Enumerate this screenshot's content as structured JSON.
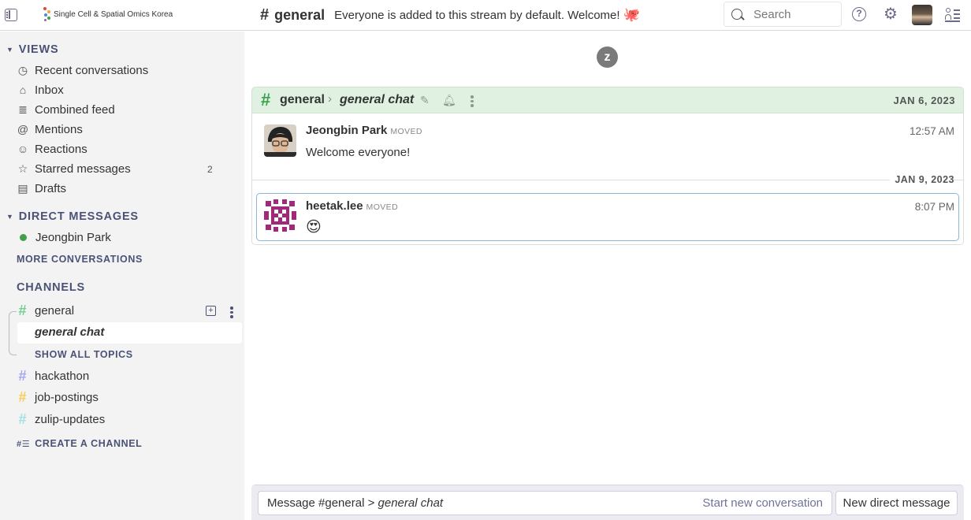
{
  "org": {
    "name": "Single Cell & Spatial Omics Korea"
  },
  "header": {
    "hash": "#",
    "stream": "general",
    "description": "Everyone is added to this stream by default. Welcome!",
    "description_emoji": "🐙",
    "search_placeholder": "Search",
    "help_label": "?"
  },
  "sidebar": {
    "views_header": "VIEWS",
    "views": [
      {
        "label": "Recent conversations",
        "icon": "clock-icon"
      },
      {
        "label": "Inbox",
        "icon": "inbox-icon"
      },
      {
        "label": "Combined feed",
        "icon": "feed-icon"
      },
      {
        "label": "Mentions",
        "icon": "at-icon"
      },
      {
        "label": "Reactions",
        "icon": "smile-icon"
      },
      {
        "label": "Starred messages",
        "icon": "star-icon",
        "count": "2"
      },
      {
        "label": "Drafts",
        "icon": "drafts-icon"
      }
    ],
    "dm_header": "DIRECT MESSAGES",
    "dm_users": [
      {
        "name": "Jeongbin Park",
        "status_color": "#44a047"
      }
    ],
    "more_conversations": "MORE CONVERSATIONS",
    "channels_header": "CHANNELS",
    "channels": [
      {
        "name": "general",
        "color": "#76ce90"
      },
      {
        "name": "hackathon",
        "color": "#a6a6f2"
      },
      {
        "name": "job-postings",
        "color": "#f8cf54"
      },
      {
        "name": "zulip-updates",
        "color": "#a3e0e6"
      }
    ],
    "topic": "general chat",
    "show_all_topics": "SHOW ALL TOPICS",
    "create_channel": "CREATE A CHANNEL"
  },
  "feed": {
    "recipient": {
      "hash": "#",
      "stream": "general",
      "chevron": "›",
      "topic": "general chat",
      "date": "JAN 6, 2023"
    },
    "messages": [
      {
        "sender": "Jeongbin Park",
        "badge": "MOVED",
        "time": "12:57 AM",
        "content": "Welcome everyone!"
      },
      {
        "sender": "heetak.lee",
        "badge": "MOVED",
        "time": "8:07 PM",
        "content": "😍",
        "date_separator": "JAN 9, 2023"
      }
    ]
  },
  "compose": {
    "placeholder_prefix": "Message #general > ",
    "placeholder_topic": "general chat",
    "start_new": "Start new conversation",
    "new_dm": "New direct message"
  },
  "colors": {
    "accent": "#4a5278",
    "stream_green": "#3aa24a",
    "recipient_bar": "#e0f1e1"
  }
}
